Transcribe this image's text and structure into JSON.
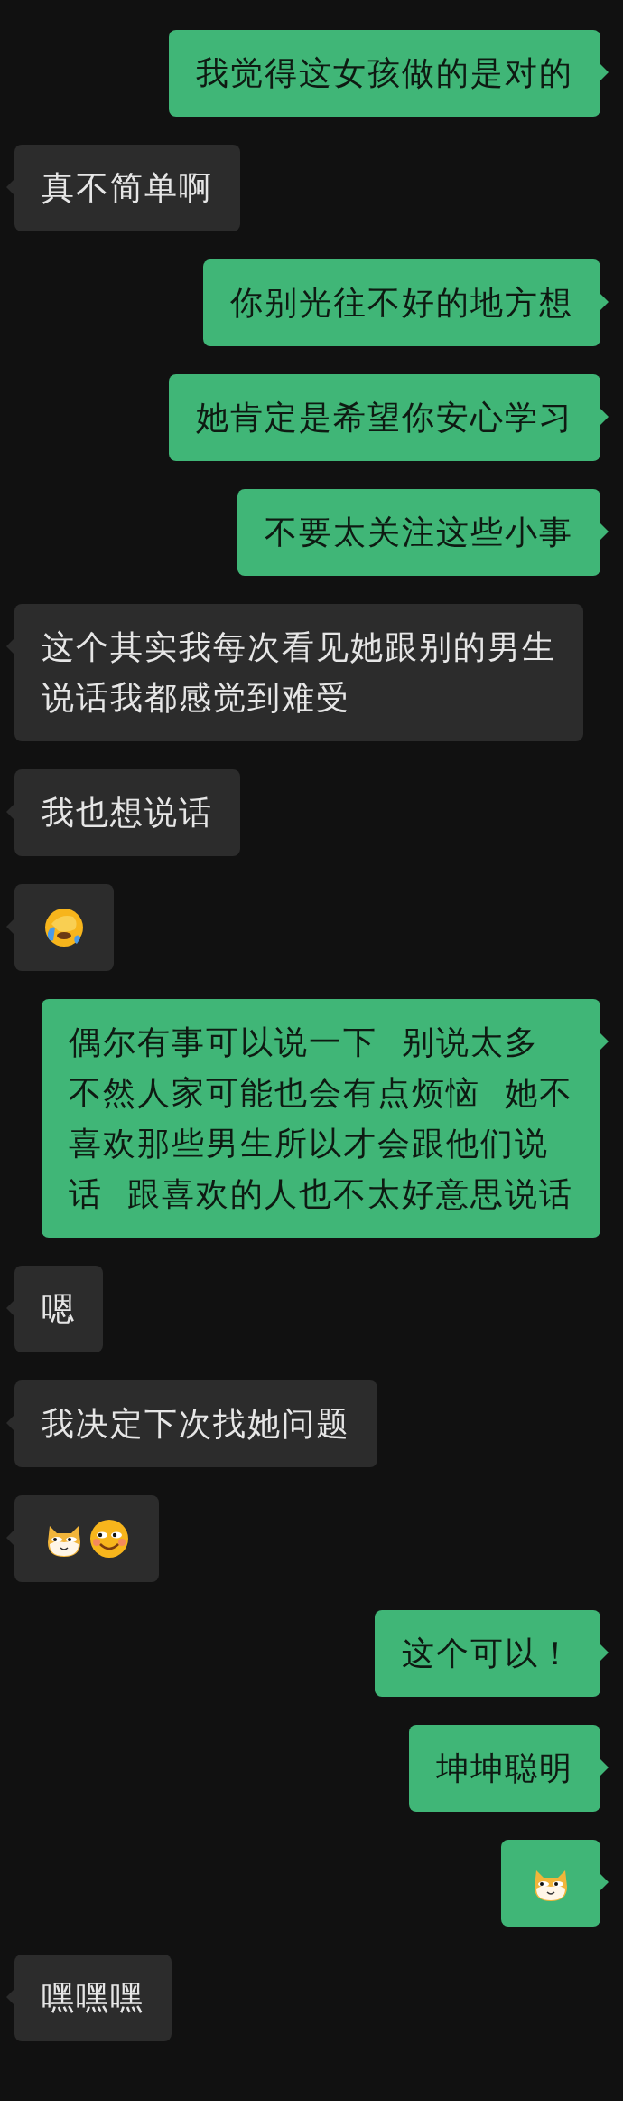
{
  "messages": [
    {
      "outgoing": true,
      "kind": "text",
      "lines": [
        "我觉得这女孩做的是对的"
      ]
    },
    {
      "outgoing": false,
      "kind": "text",
      "lines": [
        "真不简单啊"
      ]
    },
    {
      "outgoing": true,
      "kind": "text",
      "lines": [
        "你别光往不好的地方想"
      ]
    },
    {
      "outgoing": true,
      "kind": "text",
      "lines": [
        "她肯定是希望你安心学习"
      ]
    },
    {
      "outgoing": true,
      "kind": "text",
      "lines": [
        "不要太关注这些小事"
      ]
    },
    {
      "outgoing": false,
      "kind": "text",
      "lines": [
        "这个其实我每次看见她跟别的男生",
        "说话我都感觉到难受"
      ]
    },
    {
      "outgoing": false,
      "kind": "text",
      "lines": [
        "我也想说话"
      ]
    },
    {
      "outgoing": false,
      "kind": "sticker",
      "stickers": [
        {
          "kind": "facepalm"
        }
      ]
    },
    {
      "outgoing": true,
      "kind": "text",
      "lines": [
        "偶尔有事可以说一下  别说太多",
        "不然人家可能也会有点烦恼  她不",
        "喜欢那些男生所以才会跟他们说",
        "话  跟喜欢的人也不太好意思说话"
      ]
    },
    {
      "outgoing": false,
      "kind": "text",
      "lines": [
        "嗯"
      ]
    },
    {
      "outgoing": false,
      "kind": "text",
      "lines": [
        "我决定下次找她问题"
      ]
    },
    {
      "outgoing": false,
      "kind": "sticker",
      "stickers": [
        {
          "kind": "doge"
        },
        {
          "kind": "smirk"
        }
      ]
    },
    {
      "outgoing": true,
      "kind": "text",
      "lines": [
        "这个可以！"
      ]
    },
    {
      "outgoing": true,
      "kind": "text",
      "lines": [
        "坤坤聪明"
      ]
    },
    {
      "outgoing": true,
      "kind": "sticker",
      "stickers": [
        {
          "kind": "doge"
        }
      ]
    },
    {
      "outgoing": false,
      "kind": "text",
      "lines": [
        "嘿嘿嘿"
      ]
    }
  ]
}
